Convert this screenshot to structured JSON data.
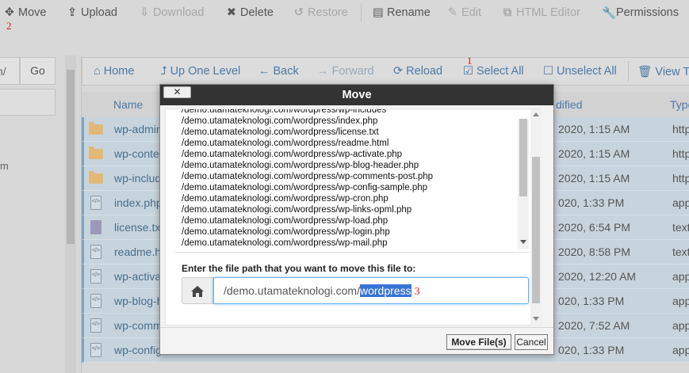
{
  "toolbar": {
    "move": "Move",
    "upload": "Upload",
    "download": "Download",
    "delete": "Delete",
    "restore": "Restore",
    "rename": "Rename",
    "edit": "Edit",
    "html_editor": "HTML Editor",
    "permissions": "Permissions"
  },
  "annotations": {
    "n1": "1",
    "n2": "2",
    "n3": "3"
  },
  "left": {
    "input_value": "n/",
    "go": "Go",
    "tree_text": "m"
  },
  "nav": {
    "home": "Home",
    "up_one_level": "Up One Level",
    "back": "Back",
    "forward": "Forward",
    "reload": "Reload",
    "select_all": "Select All",
    "unselect_all": "Unselect All",
    "view_trash": "View Tra"
  },
  "columns": {
    "name": "Name",
    "modified": "dified",
    "type": "Type"
  },
  "files": [
    {
      "name": "wp-admin",
      "date": "2020, 1:15 AM",
      "type": "http",
      "icon": "folder-icon"
    },
    {
      "name": "wp-content",
      "date": "2020, 1:15 AM",
      "type": "http",
      "icon": "folder-icon"
    },
    {
      "name": "wp-includes",
      "date": "2020, 1:15 AM",
      "type": "http",
      "icon": "folder-icon"
    },
    {
      "name": "index.php",
      "date": "020, 1:33 PM",
      "type": "appl",
      "icon": "php-file-icon"
    },
    {
      "name": "license.txt",
      "date": "2020, 6:54 PM",
      "type": "text",
      "icon": "text-file-icon"
    },
    {
      "name": "readme.html",
      "date": "2020, 8:58 PM",
      "type": "text",
      "icon": "html-file-icon"
    },
    {
      "name": "wp-activate.php",
      "date": "2020, 12:20 AM",
      "type": "appl",
      "icon": "php-file-icon"
    },
    {
      "name": "wp-blog-header.php",
      "date": "020, 1:33 PM",
      "type": "appl",
      "icon": "php-file-icon"
    },
    {
      "name": "wp-comments-post.php",
      "date": "2020, 7:52 AM",
      "type": "appl",
      "icon": "php-file-icon"
    },
    {
      "name": "wp-config-sample.php",
      "date": "020, 1:33 PM",
      "type": "appl",
      "icon": "php-file-icon"
    }
  ],
  "modal": {
    "title": "Move",
    "close": "✕",
    "paths": [
      "/demo.utamateknologi.com/wordpress/wp-includes",
      "/demo.utamateknologi.com/wordpress/index.php",
      "/demo.utamateknologi.com/wordpress/license.txt",
      "/demo.utamateknologi.com/wordpress/readme.html",
      "/demo.utamateknologi.com/wordpress/wp-activate.php",
      "/demo.utamateknologi.com/wordpress/wp-blog-header.php",
      "/demo.utamateknologi.com/wordpress/wp-comments-post.php",
      "/demo.utamateknologi.com/wordpress/wp-config-sample.php",
      "/demo.utamateknologi.com/wordpress/wp-cron.php",
      "/demo.utamateknologi.com/wordpress/wp-links-opml.php",
      "/demo.utamateknologi.com/wordpress/wp-load.php",
      "/demo.utamateknologi.com/wordpress/wp-login.php",
      "/demo.utamateknologi.com/wordpress/wp-mail.php"
    ],
    "prompt": "Enter the file path that you want to move this file to:",
    "input_prefix": "/demo.utamateknologi.com/",
    "input_selected": "wordpress",
    "move_button": "Move File(s)",
    "cancel_button": "Cancel"
  }
}
